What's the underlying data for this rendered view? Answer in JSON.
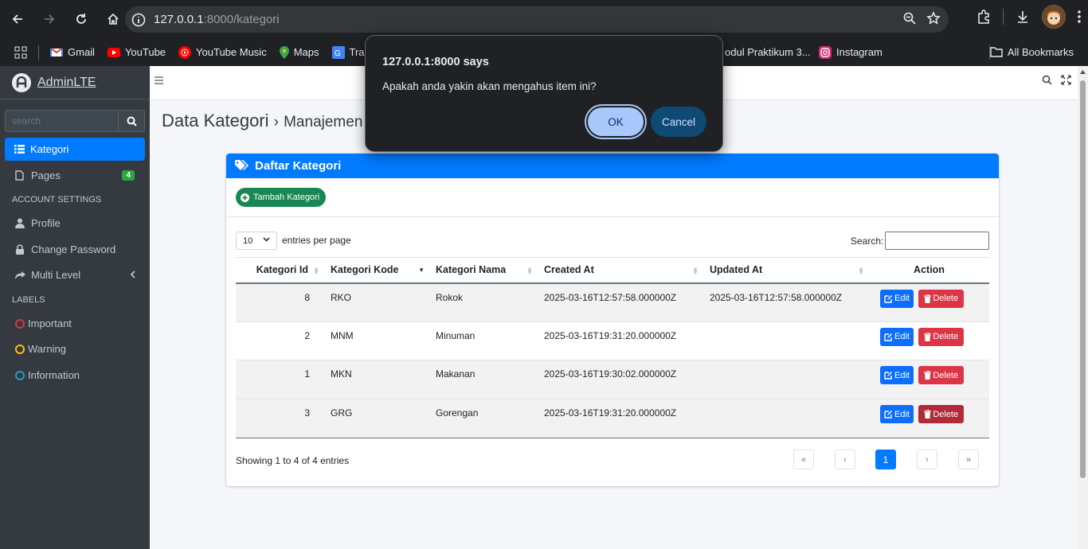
{
  "browser": {
    "url_host": "127.0.0.1",
    "url_rest": ":8000/kategori",
    "bookmarks": [
      {
        "label": "Gmail",
        "color": "#ea4335"
      },
      {
        "label": "YouTube",
        "color": "#ff0000"
      },
      {
        "label": "YouTube Music",
        "color": "#ff0000"
      },
      {
        "label": "Maps",
        "color": "#34a853"
      },
      {
        "label": "Transl",
        "color": "#4285f4"
      }
    ],
    "bookmark_partial": "odul Praktikum 3...",
    "bookmark_instagram": "Instagram",
    "all_bookmarks": "All Bookmarks"
  },
  "sidebar": {
    "brand": "AdminLTE",
    "brand_bold": "Admin",
    "brand_light": "LTE",
    "search_placeholder": "search",
    "items": {
      "kategori": "Kategori",
      "pages": "Pages",
      "pages_badge": "4",
      "profile": "Profile",
      "change_password": "Change Password",
      "multi_level": "Multi Level",
      "important": "Important",
      "warning": "Warning",
      "information": "Information"
    },
    "headers": {
      "account": "ACCOUNT SETTINGS",
      "labels": "LABELS"
    }
  },
  "page": {
    "title": "Data Kategori",
    "separator": "›",
    "subtitle": "Manajemen"
  },
  "card": {
    "title": "Daftar Kategori",
    "add_button": "Tambah Kategori",
    "length_value": "10",
    "length_label": "entries per page",
    "search_label": "Search:",
    "columns": [
      "Kategori Id",
      "Kategori Kode",
      "Kategori Nama",
      "Created At",
      "Updated At",
      "Action"
    ],
    "rows": [
      {
        "id": "8",
        "kode": "RKO",
        "nama": "Rokok",
        "created": "2025-03-16T12:57:58.000000Z",
        "updated": "2025-03-16T12:57:58.000000Z"
      },
      {
        "id": "2",
        "kode": "MNM",
        "nama": "Minuman",
        "created": "2025-03-16T19:31:20.000000Z",
        "updated": ""
      },
      {
        "id": "1",
        "kode": "MKN",
        "nama": "Makanan",
        "created": "2025-03-16T19:30:02.000000Z",
        "updated": ""
      },
      {
        "id": "3",
        "kode": "GRG",
        "nama": "Gorengan",
        "created": "2025-03-16T19:31:20.000000Z",
        "updated": ""
      }
    ],
    "edit_label": "Edit",
    "delete_label": "Delete",
    "info": "Showing 1 to 4 of 4 entries",
    "pagination": {
      "first": "«",
      "prev": "‹",
      "current": "1",
      "next": "›",
      "last": "»"
    }
  },
  "dialog": {
    "title": "127.0.0.1:8000 says",
    "message": "Apakah anda yakin akan mengahus item ini?",
    "ok": "OK",
    "cancel": "Cancel"
  }
}
